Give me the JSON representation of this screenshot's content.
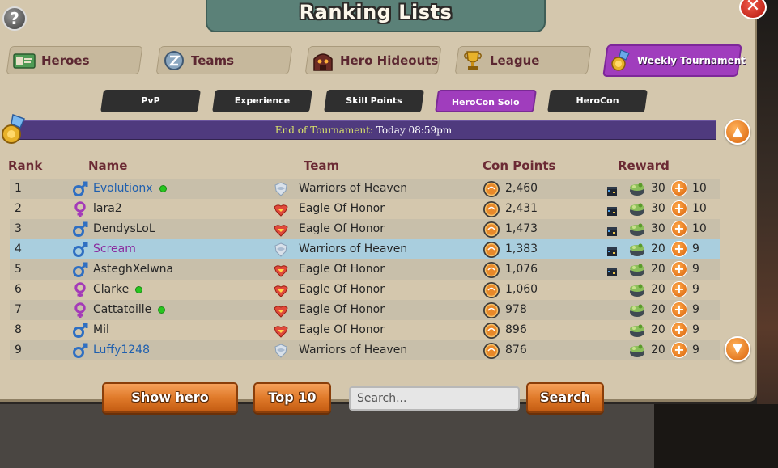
{
  "title": "Ranking Lists",
  "categories": [
    {
      "label": "Heroes",
      "icon": "hero-card-icon"
    },
    {
      "label": "Teams",
      "icon": "team-badge-icon"
    },
    {
      "label": "Hero Hideouts",
      "icon": "hideout-icon"
    },
    {
      "label": "League",
      "icon": "trophy-icon"
    },
    {
      "label": "Weekly Tournament",
      "icon": "medal-icon",
      "active": true
    }
  ],
  "subtabs": [
    {
      "label": "PvP"
    },
    {
      "label": "Experience"
    },
    {
      "label": "Skill Points"
    },
    {
      "label": "HeroCon Solo",
      "active": true
    },
    {
      "label": "HeroCon"
    }
  ],
  "banner": {
    "label": "End of Tournament:",
    "value": "Today 08:59pm"
  },
  "columns": {
    "rank": "Rank",
    "name": "Name",
    "team": "Team",
    "points": "Con Points",
    "reward": "Reward"
  },
  "rows": [
    {
      "rank": "1",
      "gender": "male",
      "name": "Evolutionx",
      "name_color": "blue",
      "online": true,
      "team_icon": "heaven-badge-icon",
      "team": "Warriors of Heaven",
      "points": "2,460",
      "box": true,
      "reward1": "30",
      "reward2": "10"
    },
    {
      "rank": "2",
      "gender": "female",
      "name": "lara2",
      "name_color": "normal",
      "online": false,
      "team_icon": "eagle-badge-icon",
      "team": "Eagle Of Honor",
      "points": "2,431",
      "box": true,
      "reward1": "30",
      "reward2": "10"
    },
    {
      "rank": "3",
      "gender": "male",
      "name": "DendysLoL",
      "name_color": "normal",
      "online": false,
      "team_icon": "eagle-badge-icon",
      "team": "Eagle Of Honor",
      "points": "1,473",
      "box": true,
      "reward1": "30",
      "reward2": "10"
    },
    {
      "rank": "4",
      "gender": "male",
      "name": "Scream",
      "name_color": "purple",
      "online": false,
      "team_icon": "heaven-badge-icon",
      "team": "Warriors of Heaven",
      "points": "1,383",
      "box": true,
      "reward1": "20",
      "reward2": "9",
      "highlight": true
    },
    {
      "rank": "5",
      "gender": "male",
      "name": "AsteghXelwna",
      "name_color": "normal",
      "online": false,
      "team_icon": "eagle-badge-icon",
      "team": "Eagle Of Honor",
      "points": "1,076",
      "box": true,
      "reward1": "20",
      "reward2": "9"
    },
    {
      "rank": "6",
      "gender": "female",
      "name": "Clarke",
      "name_color": "normal",
      "online": true,
      "team_icon": "eagle-badge-icon",
      "team": "Eagle Of Honor",
      "points": "1,060",
      "box": false,
      "reward1": "20",
      "reward2": "9"
    },
    {
      "rank": "7",
      "gender": "female",
      "name": "Cattatoille",
      "name_color": "normal",
      "online": true,
      "team_icon": "eagle-badge-icon",
      "team": "Eagle Of Honor",
      "points": "978",
      "box": false,
      "reward1": "20",
      "reward2": "9"
    },
    {
      "rank": "8",
      "gender": "male",
      "name": "Mil",
      "name_color": "normal",
      "online": false,
      "team_icon": "eagle-badge-icon",
      "team": "Eagle Of Honor",
      "points": "896",
      "box": false,
      "reward1": "20",
      "reward2": "9"
    },
    {
      "rank": "9",
      "gender": "male",
      "name": "Luffy1248",
      "name_color": "blue",
      "online": false,
      "team_icon": "heaven-badge-icon",
      "team": "Warriors of Heaven",
      "points": "876",
      "box": false,
      "reward1": "20",
      "reward2": "9"
    }
  ],
  "buttons": {
    "show_hero": "Show hero",
    "top10": "Top 10",
    "search": "Search"
  },
  "search": {
    "placeholder": "Search...",
    "value": ""
  },
  "colors": {
    "accent_purple": "#a03dbd",
    "banner": "#4f3a7e",
    "highlight_row": "#a9cede",
    "orange_button": "#e07a2a",
    "title_tab": "#5b8178"
  }
}
